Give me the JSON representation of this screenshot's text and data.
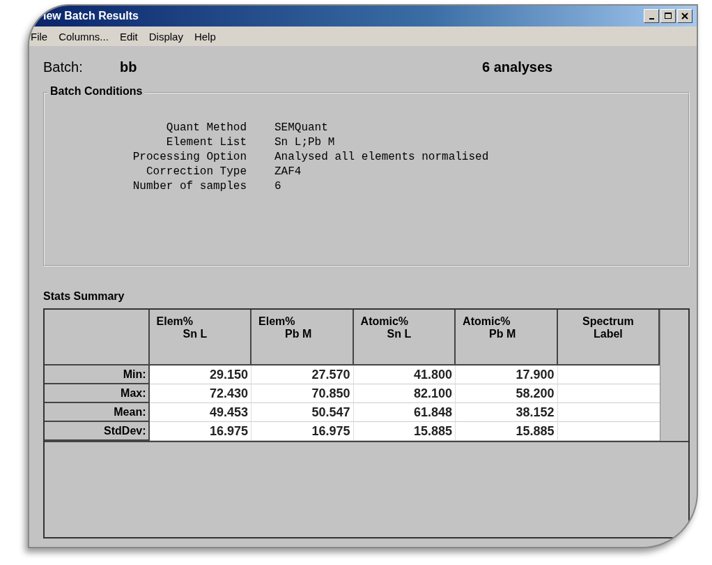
{
  "window": {
    "title": "iew Batch Results",
    "controls": [
      {
        "kind": "minimize"
      },
      {
        "kind": "maximize"
      },
      {
        "kind": "close"
      }
    ]
  },
  "menu": [
    "File",
    "Columns...",
    "Edit",
    "Display",
    "Help"
  ],
  "batch": {
    "label": "Batch:",
    "name": "bb",
    "count": "6 analyses"
  },
  "conditions": {
    "title": "Batch Conditions",
    "rows": [
      {
        "label": "Quant Method",
        "value": "SEMQuant"
      },
      {
        "label": "Element List",
        "value": "Sn L;Pb M"
      },
      {
        "label": "Processing Option",
        "value": "Analysed all elements normalised"
      },
      {
        "label": "Correction Type",
        "value": "ZAF4"
      },
      {
        "label": "Number of samples",
        "value": "6"
      }
    ]
  },
  "stats": {
    "title": "Stats Summary",
    "columns": [
      [
        "Elem%",
        "Sn L"
      ],
      [
        "Elem%",
        "Pb M"
      ],
      [
        "Atomic%",
        "Sn L"
      ],
      [
        "Atomic%",
        "Pb M"
      ],
      [
        "Spectrum",
        "Label"
      ]
    ],
    "rows": [
      {
        "label": "Min:",
        "values": [
          "29.150",
          "27.570",
          "41.800",
          "17.900"
        ]
      },
      {
        "label": "Max:",
        "values": [
          "72.430",
          "70.850",
          "82.100",
          "58.200"
        ]
      },
      {
        "label": "Mean:",
        "values": [
          "49.453",
          "50.547",
          "61.848",
          "38.152"
        ]
      },
      {
        "label": "StdDev:",
        "values": [
          "16.975",
          "16.975",
          "15.885",
          "15.885"
        ]
      }
    ]
  }
}
